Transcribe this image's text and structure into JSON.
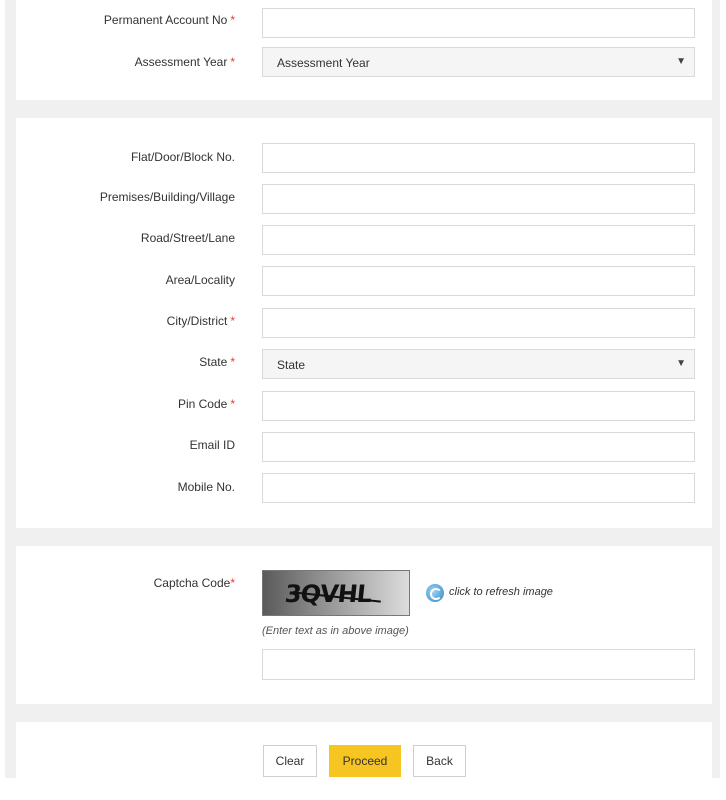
{
  "form": {
    "pan": {
      "label": "Permanent Account No",
      "required_mark": "*",
      "value": ""
    },
    "assessment_year": {
      "label": "Assessment Year",
      "required_mark": "*",
      "selected": "Assessment Year"
    },
    "flat": {
      "label": "Flat/Door/Block No.",
      "value": ""
    },
    "premises": {
      "label": "Premises/Building/Village",
      "value": ""
    },
    "road": {
      "label": "Road/Street/Lane",
      "value": ""
    },
    "area": {
      "label": "Area/Locality",
      "value": ""
    },
    "city": {
      "label": "City/District",
      "required_mark": "*",
      "value": ""
    },
    "state": {
      "label": "State",
      "required_mark": "*",
      "selected": "State"
    },
    "pin": {
      "label": "Pin Code",
      "required_mark": "*",
      "value": ""
    },
    "email": {
      "label": "Email ID",
      "value": ""
    },
    "mobile": {
      "label": "Mobile No.",
      "value": ""
    }
  },
  "captcha": {
    "label": "Captcha Code",
    "required_mark": "*",
    "image_text": "3QVHL",
    "refresh_text": "click to refresh image",
    "hint": "(Enter text as in above image)",
    "value": ""
  },
  "buttons": {
    "clear": "Clear",
    "proceed": "Proceed",
    "back": "Back"
  },
  "colors": {
    "accent": "#f6c521",
    "required": "#e63b3b",
    "background": "#f0f0f0"
  },
  "icons": {
    "select_arrow": "chevron-down-icon",
    "refresh": "refresh-icon"
  }
}
